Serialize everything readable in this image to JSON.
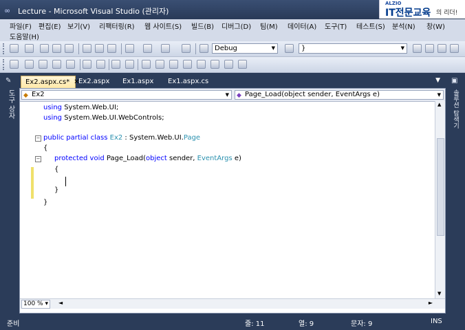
{
  "window": {
    "title": "Lecture - Microsoft Visual Studio (관리자)"
  },
  "brand": {
    "small": "ALZIO",
    "big": "IT전문교육",
    "tail": "의 리더!"
  },
  "menu": [
    "파일(F)",
    "편집(E)",
    "보기(V)",
    "리팩터링(R)",
    "웹 사이트(S)",
    "빌드(B)",
    "디버그(D)",
    "팀(M)",
    "데이터(A)",
    "도구(T)",
    "테스트(S)",
    "분석(N)",
    "창(W)",
    "도움말(H)"
  ],
  "toolbar": {
    "config": "Debug",
    "search": "}"
  },
  "tabs": [
    {
      "label": "Ex2.aspx.cs*",
      "active": true
    },
    {
      "label": "Ex2.aspx"
    },
    {
      "label": "Ex1.aspx"
    },
    {
      "label": "Ex1.aspx.cs"
    }
  ],
  "left_panel": {
    "label": "도구 상자"
  },
  "right_panel": {
    "label": "솔루션 탐색기"
  },
  "nav": {
    "class_combo": "Ex2",
    "member_combo": "Page_Load(object sender, EventArgs e)"
  },
  "code": [
    {
      "kw": "using",
      "rest": " System.Web.UI;"
    },
    {
      "kw": "using",
      "rest": " System.Web.UI.WebControls;"
    },
    {
      "kw": "public partial class",
      "type": " Ex2",
      "rest": " : System.Web.UI.",
      "type2": "Page"
    },
    {
      "text": "{"
    },
    {
      "kw": "protected void",
      "rest": " Page_Load(",
      "kw2": "object",
      "rest2": " sender, ",
      "type": "EventArgs",
      "rest3": " e)"
    },
    {
      "text": "{"
    },
    {
      "text": "}"
    },
    {
      "text": "}"
    }
  ],
  "zoom": "100 %",
  "status": {
    "ready": "준비",
    "line": "줄: 11",
    "col": "열: 9",
    "char": "문자: 9",
    "mode": "INS"
  }
}
